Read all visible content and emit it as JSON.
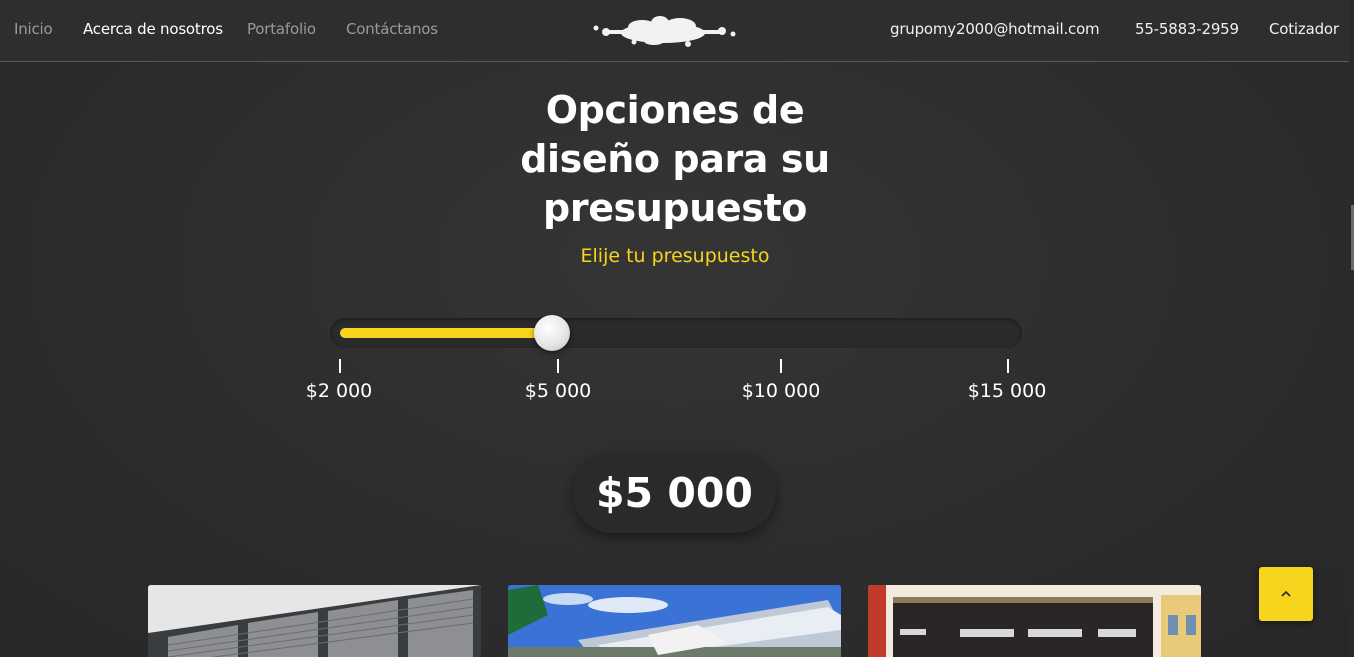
{
  "nav": {
    "left": [
      {
        "label": "Inicio"
      },
      {
        "label": "Acerca de nosotros"
      },
      {
        "label": "Portafolio"
      },
      {
        "label": "Contáctanos"
      }
    ],
    "email": "grupomy2000@hotmail.com",
    "phone": "55-5883-2959",
    "quote": "Cotizador",
    "logo_icon": "paint-splash-logo"
  },
  "hero": {
    "title": "Opciones de diseño para su presupuesto",
    "subtitle": "Elije tu presupuesto"
  },
  "slider": {
    "options": [
      "$2 000",
      "$5 000",
      "$10 000",
      "$15 000"
    ],
    "selected_index": 1,
    "selected_fraction": 0.315
  },
  "price": "$5 000",
  "cards": [
    {
      "image_icon": "window-blinds-image"
    },
    {
      "image_icon": "glass-canopy-image"
    },
    {
      "image_icon": "garage-door-image"
    }
  ],
  "back_to_top_icon": "chevron-up-icon",
  "colors": {
    "accent": "#f7d41e",
    "background": "#2f2f2f",
    "text": "#ffffff",
    "nav_inactive": "#9a9a9a"
  }
}
